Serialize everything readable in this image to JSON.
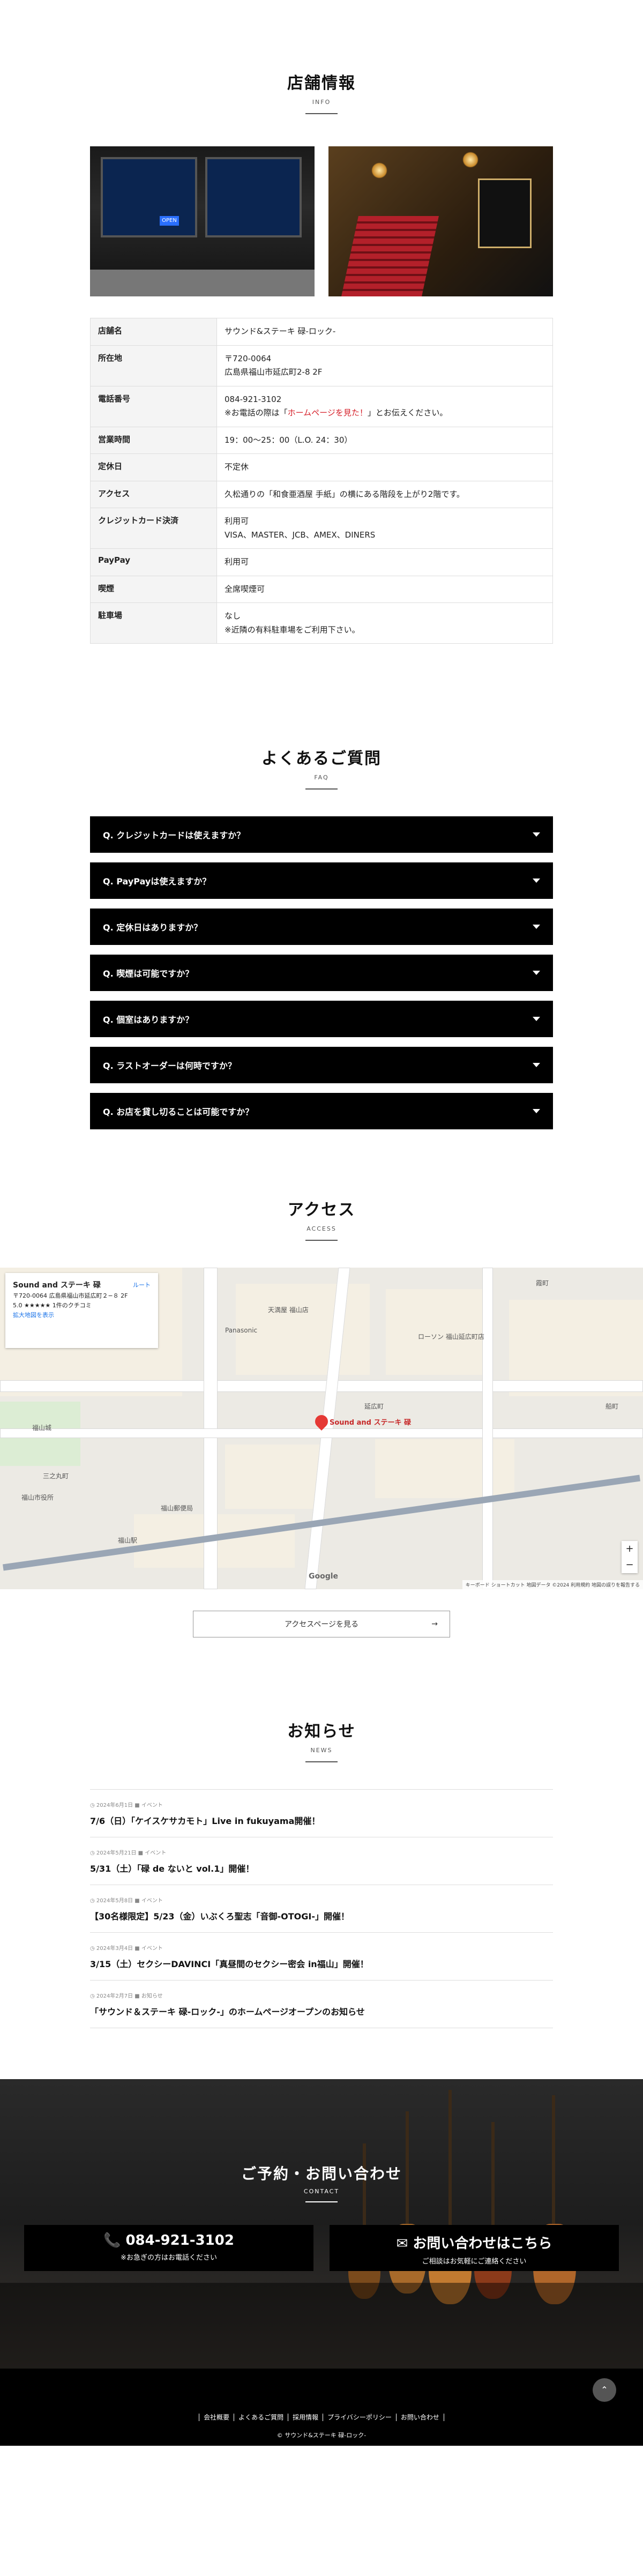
{
  "info": {
    "title": "店舗情報",
    "en": "INFO",
    "photo1_sign": "OPEN",
    "rows": [
      {
        "label": "店舗名",
        "value": "サウンド&ステーキ 碌-ロック-"
      },
      {
        "label": "所在地",
        "value": "〒720-0064",
        "value2": "広島県福山市延広町2-8 2F"
      },
      {
        "label": "電話番号",
        "value": "084-921-3102",
        "note_pre": "※お電話の際は「",
        "note_red": "ホームページを見た！",
        "note_post": "」とお伝えください。"
      },
      {
        "label": "営業時間",
        "value": "19：00〜25：00（L.O. 24：30）"
      },
      {
        "label": "定休日",
        "value": "不定休"
      },
      {
        "label": "アクセス",
        "value": "久松通りの「和食亜酒屋 手紙」の横にある階段を上がり2階です。"
      },
      {
        "label": "クレジットカード決済",
        "value": "利用可",
        "value2": "VISA、MASTER、JCB、AMEX、DINERS"
      },
      {
        "label": "PayPay",
        "value": "利用可"
      },
      {
        "label": "喫煙",
        "value": "全席喫煙可"
      },
      {
        "label": "駐車場",
        "value": "なし",
        "value2": "※近隣の有料駐車場をご利用下さい。"
      }
    ]
  },
  "faq": {
    "title": "よくあるご質問",
    "en": "FAQ",
    "items": [
      "Q.  クレジットカードは使えますか？",
      "Q.  PayPayは使えますか？",
      "Q.  定休日はありますか？",
      "Q.  喫煙は可能ですか？",
      "Q.  個室はありますか？",
      "Q.  ラストオーダーは何時ですか？",
      "Q.  お店を貸し切ることは可能ですか？"
    ]
  },
  "access": {
    "title": "アクセス",
    "en": "ACCESS",
    "map_card": {
      "name": "Sound and ステーキ 碌",
      "address": "〒720-0064 広島県福山市延広町２−８ 2F",
      "rating": "5.0 ★★★★★ 1件のクチコミ",
      "route": "ルート",
      "enlarge": "拡大地図を表示"
    },
    "pin_label": "Sound and ステーキ 碌",
    "map_labels": [
      "福山城",
      "福山駅",
      "福山市役所",
      "ローソン 福山延広町店",
      "Panasonic",
      "天満屋 福山店",
      "福山郵便局",
      "延広町",
      "船町",
      "霞町",
      "三之丸町"
    ],
    "attribution": "キーボード ショートカット  地図データ ©2024  利用規約  地図の誤りを報告する",
    "google": "Google",
    "button": "アクセスページを見る",
    "button_arrow": "→"
  },
  "news": {
    "title": "お知らせ",
    "en": "NEWS",
    "items": [
      {
        "meta": "◷ 2024年6月1日  ■ イベント",
        "title": "7/6（日）「ケイスケサカモト」Live in fukuyama開催！"
      },
      {
        "meta": "◷ 2024年5月21日  ■ イベント",
        "title": "5/31（土）「碌 de ないと vol.1」開催！"
      },
      {
        "meta": "◷ 2024年5月8日  ■ イベント",
        "title": "【30名様限定】5/23（金）いぶくろ聖志「音御-OTOGI-」開催！"
      },
      {
        "meta": "◷ 2024年3月4日  ■ イベント",
        "title": "3/15（土）セクシーDAVINCI「真昼間のセクシー密会 in福山」開催！"
      },
      {
        "meta": "◷ 2024年2月7日  ■ お知らせ",
        "title": "「サウンド＆ステーキ 碌-ロック-」のホームページオープンのお知らせ"
      }
    ]
  },
  "contact": {
    "title": "ご予約・お問い合わせ",
    "en": "CONTACT",
    "phone": "📞 084-921-3102",
    "phone_sub": "※お急ぎの方はお電話ください",
    "mail": "✉ お問い合わせはこちら",
    "mail_sub": "ご相談はお気軽にご連絡ください"
  },
  "footer": {
    "nav": [
      "会社概要",
      "よくあるご質問",
      "採用情報",
      "プライバシーポリシー",
      "お問い合わせ"
    ],
    "copyright": "© サウンド&ステーキ 碌-ロック-",
    "totop": "⌃"
  },
  "colors": {
    "accent_red": "#d6202a",
    "faq_bg": "#000000"
  }
}
